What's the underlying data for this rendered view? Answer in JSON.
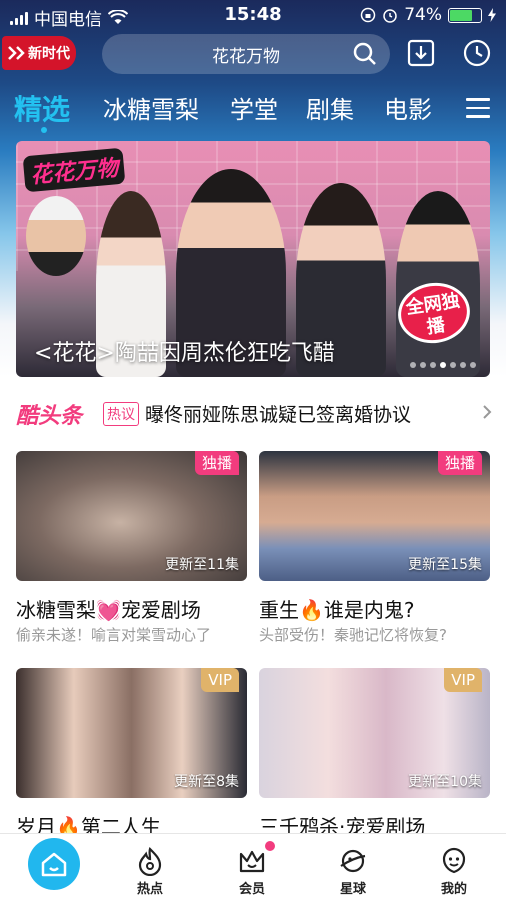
{
  "status_bar": {
    "carrier": "中国电信",
    "time": "15:48",
    "battery": "74%"
  },
  "header": {
    "logo_text": "新时代",
    "search_placeholder": "花花万物"
  },
  "tabs": [
    {
      "label": "精选",
      "active": true
    },
    {
      "label": "冰糖雪梨",
      "active": false
    },
    {
      "label": "学堂",
      "active": false
    },
    {
      "label": "剧集",
      "active": false
    },
    {
      "label": "电影",
      "active": false
    }
  ],
  "banner": {
    "logo": "花花万物",
    "title": "<花花>陶喆因周杰伦狂吃飞醋",
    "tag": "全网独播",
    "page_dots": 7,
    "active_dot": 3
  },
  "headline": {
    "brand": "酷头条",
    "tag": "热议",
    "text": "曝佟丽娅陈思诚疑已签离婚协议"
  },
  "cards": [
    {
      "badge": "独播",
      "badge_color": "#f23c7e",
      "update": "更新至11集",
      "title": "冰糖雪梨💓宠爱剧场",
      "subtitle": "偷亲未遂！喻言对棠雪动心了"
    },
    {
      "badge": "独播",
      "badge_color": "#f23c7e",
      "update": "更新至15集",
      "title": "重生🔥谁是内鬼?",
      "subtitle": "头部受伤！秦驰记忆将恢复?"
    },
    {
      "badge": "VIP",
      "badge_color": "#e0b36a",
      "update": "更新至8集",
      "title": "岁月🔥第二人生",
      "subtitle": ""
    },
    {
      "badge": "VIP",
      "badge_color": "#e0b36a",
      "update": "更新至10集",
      "title": "三千鸦杀·宠爱剧场",
      "subtitle": ""
    }
  ],
  "bottom_nav": [
    {
      "label": "",
      "icon": "home-icon",
      "active": true
    },
    {
      "label": "热点",
      "icon": "fire-icon"
    },
    {
      "label": "会员",
      "icon": "crown-icon",
      "badge_dot": true
    },
    {
      "label": "星球",
      "icon": "planet-icon"
    },
    {
      "label": "我的",
      "icon": "profile-icon"
    }
  ],
  "colors": {
    "accent": "#23c1f0",
    "pink": "#f23c7e",
    "vip_gold": "#e0b36a"
  }
}
